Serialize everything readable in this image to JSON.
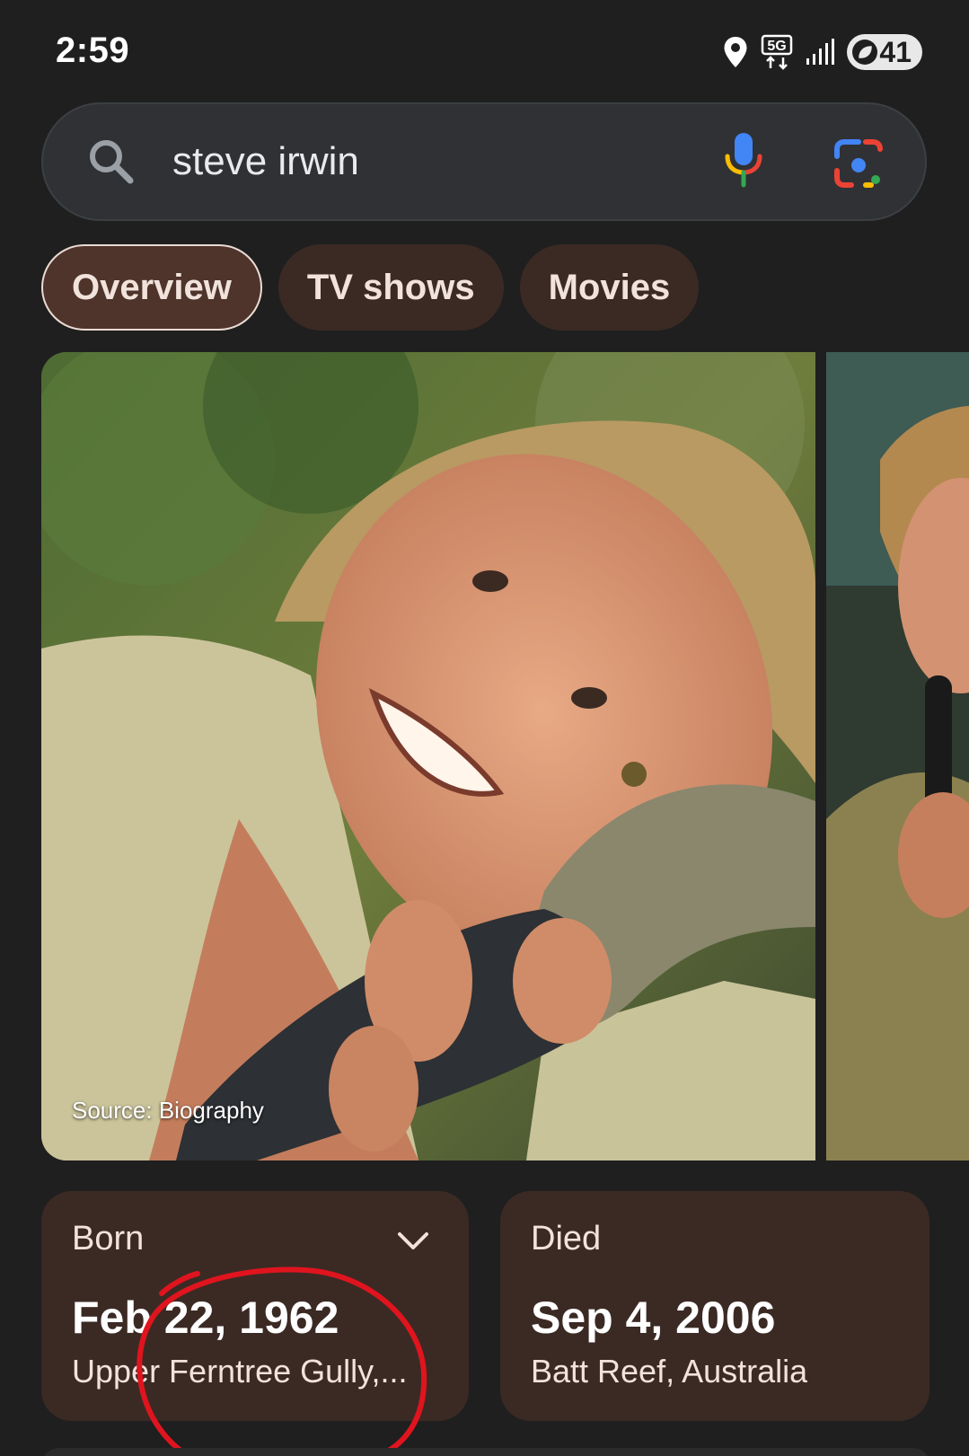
{
  "status_bar": {
    "time": "2:59",
    "network": "5G",
    "battery_level": "41",
    "icons": [
      "location-icon",
      "5g-icon",
      "signal-icon",
      "battery-icon"
    ]
  },
  "search": {
    "query": "steve irwin",
    "icons": [
      "search-icon",
      "mic-icon",
      "lens-icon"
    ]
  },
  "tabs": [
    {
      "label": "Overview",
      "active": true
    },
    {
      "label": "TV shows",
      "active": false
    },
    {
      "label": "Movies",
      "active": false
    }
  ],
  "image_carousel": {
    "main_caption": "Source: Biography"
  },
  "facts": {
    "born": {
      "label": "Born",
      "date": "Feb 22, 1962",
      "place": "Upper Ferntree Gully,..."
    },
    "died": {
      "label": "Died",
      "date": "Sep 4, 2006",
      "place": "Batt Reef, Australia"
    }
  },
  "colors": {
    "background": "#1f1f1f",
    "chip": "#3b2a24",
    "card": "#3b2a24",
    "annotation": "#e0141e"
  }
}
